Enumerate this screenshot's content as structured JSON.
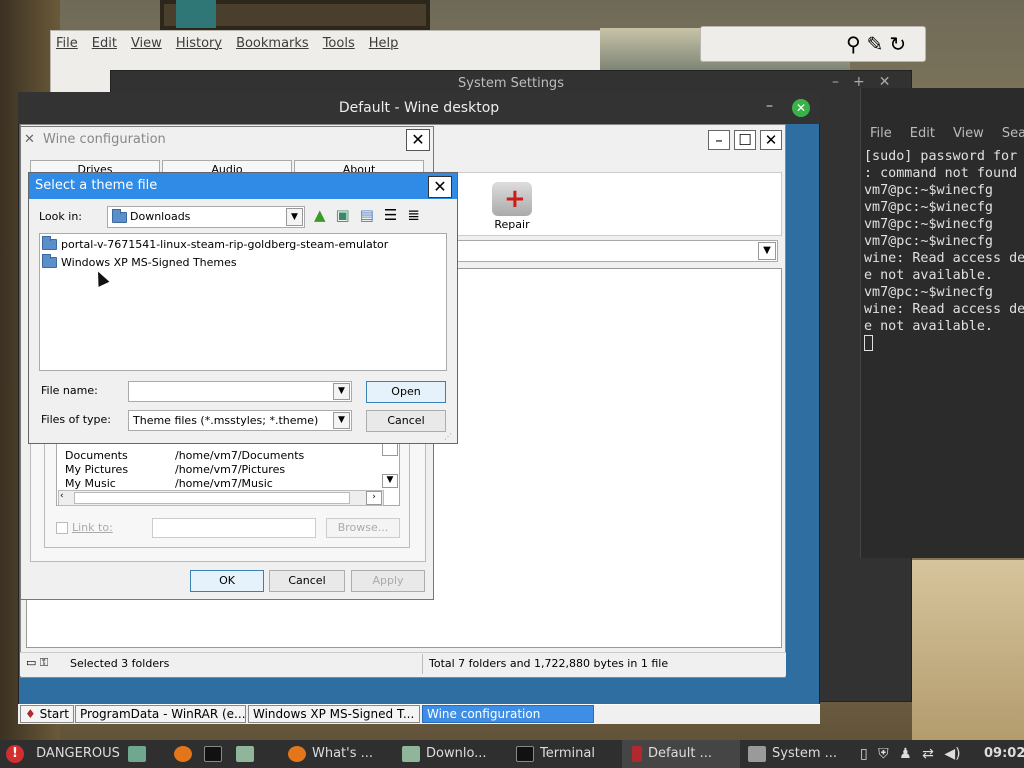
{
  "firefox": {
    "menu": [
      "File",
      "Edit",
      "View",
      "History",
      "Bookmarks",
      "Tools",
      "Help"
    ]
  },
  "system_settings": {
    "title": "System Settings"
  },
  "terminal": {
    "menu": [
      "File",
      "Edit",
      "View",
      "Search"
    ],
    "lines": [
      "[sudo] password for",
      ": command not found",
      "vm7@pc:~$winecfg",
      "vm7@pc:~$winecfg",
      "vm7@pc:~$winecfg",
      "vm7@pc:~$winecfg",
      "wine: Read access de",
      "e not available.",
      "vm7@pc:~$winecfg",
      "wine: Read access de",
      "e not available."
    ]
  },
  "wine_desktop": {
    "title": "Default - Wine desktop"
  },
  "explorer": {
    "repair_label": "Repair",
    "status_left": "Selected 3 folders",
    "status_right": "Total 7 folders and 1,722,880 bytes in 1 file"
  },
  "wine_config": {
    "title": "Wine configuration",
    "tabs": [
      "Drives",
      "Audio",
      "About"
    ],
    "folders": [
      {
        "name": "Documents",
        "path": "/home/vm7/Documents"
      },
      {
        "name": "My Pictures",
        "path": "/home/vm7/Pictures"
      },
      {
        "name": "My Music",
        "path": "/home/vm7/Music"
      }
    ],
    "link_to_label": "Link to:",
    "browse_label": "Browse...",
    "ok_label": "OK",
    "cancel_label": "Cancel",
    "apply_label": "Apply"
  },
  "theme_dialog": {
    "title": "Select a theme file",
    "look_in_label": "Look in:",
    "look_in_value": "Downloads",
    "files": [
      "portal-v-7671541-linux-steam-rip-goldberg-steam-emulator",
      "Windows XP MS-Signed Themes"
    ],
    "file_name_label": "File name:",
    "file_name_value": "",
    "files_of_type_label": "Files of type:",
    "files_of_type_value": "Theme files (*.msstyles; *.theme)",
    "open_label": "Open",
    "cancel_label": "Cancel"
  },
  "wine_taskbar": {
    "start_label": "Start",
    "items": [
      "ProgramData - WinRAR (e...",
      "Windows XP MS-Signed T...",
      "Wine configuration"
    ]
  },
  "panel": {
    "menu_label": "DANGEROUS",
    "tasks": [
      "What's ...",
      "Downlo...",
      "Terminal",
      "Default ...",
      "System ..."
    ],
    "clock": "09:02"
  },
  "colors": {
    "dialog_title_bg": "#2f8be6",
    "wine_desktop_bg": "#2e6ea0",
    "wine_task_active": "#3d8ee4",
    "panel_bg": "#2f2f2f"
  }
}
